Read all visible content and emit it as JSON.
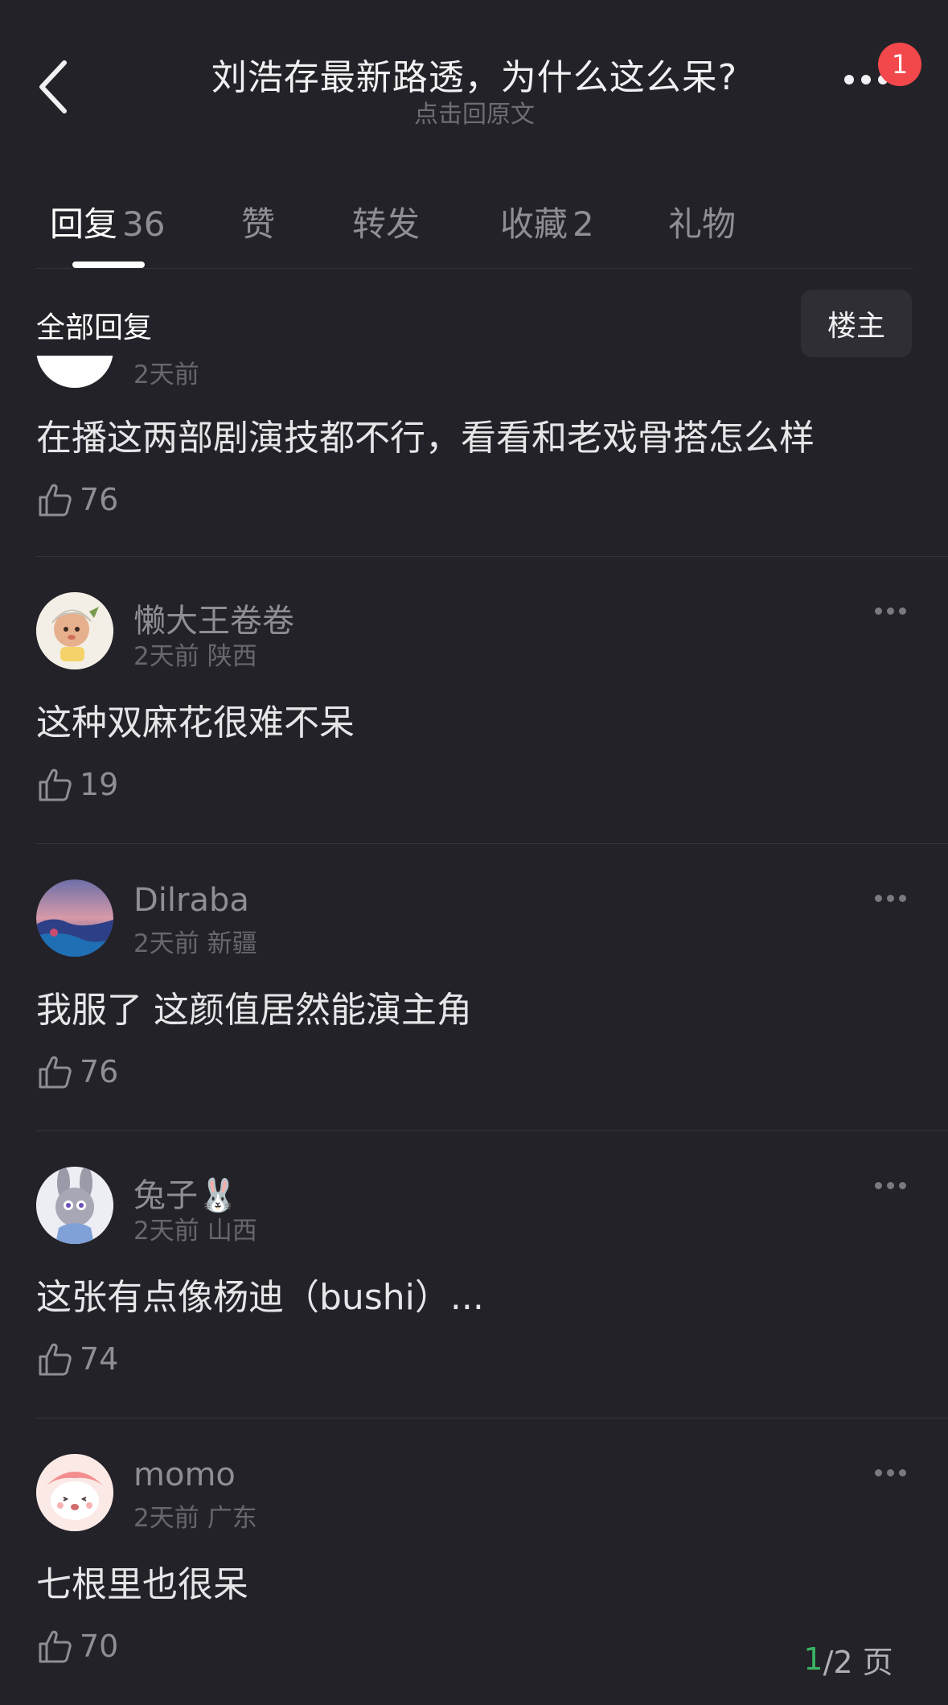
{
  "header": {
    "title": "刘浩存最新路透，为什么这么呆?",
    "subtitle": "点击回原文",
    "notification_count": "1"
  },
  "tabs": [
    {
      "label": "回复",
      "count": "36",
      "active": true
    },
    {
      "label": "赞",
      "count": ""
    },
    {
      "label": "转发",
      "count": ""
    },
    {
      "label": "收藏",
      "count": "2"
    },
    {
      "label": "礼物",
      "count": ""
    }
  ],
  "filter": {
    "label": "全部回复",
    "owner_button": "楼主"
  },
  "comments": [
    {
      "username": "",
      "time": "2天前",
      "region": "",
      "text": "在播这两部剧演技都不行，看看和老戏骨搭怎么样",
      "likes": "76",
      "partial": true
    },
    {
      "username": "懒大王卷卷",
      "time": "2天前",
      "region": "陕西",
      "text": "这种双麻花很难不呆",
      "likes": "19"
    },
    {
      "username": "Dilraba",
      "time": "2天前",
      "region": "新疆",
      "text": "我服了 这颜值居然能演主角",
      "likes": "76"
    },
    {
      "username": "兔子🐰",
      "time": "2天前",
      "region": "山西",
      "text": "这张有点像杨迪（bushi）...",
      "likes": "74"
    },
    {
      "username": "momo",
      "time": "2天前",
      "region": "广东",
      "text": "七根里也很呆",
      "likes": "70"
    }
  ],
  "pagination": {
    "current": "1",
    "total_text": "/2 页"
  },
  "colors": {
    "background": "#232228",
    "accent_green": "#3ab464",
    "badge_red": "#f2484b"
  }
}
